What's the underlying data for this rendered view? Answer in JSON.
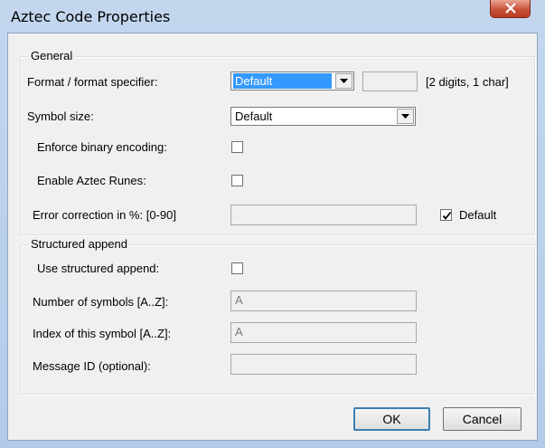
{
  "window": {
    "title": "Aztec Code Properties",
    "close_icon": "close-icon"
  },
  "general": {
    "legend": "General",
    "format_label": "Format / format specifier:",
    "format_value": "Default",
    "format_hint": "[2 digits, 1 char]",
    "format_specifier_value": "",
    "symbol_size_label": "Symbol size:",
    "symbol_size_value": "Default",
    "binary_label": "Enforce binary encoding:",
    "binary_checked": false,
    "runes_label": "Enable Aztec Runes:",
    "runes_checked": false,
    "ecc_label": "Error correction in %: [0-90]",
    "ecc_value": "",
    "ecc_default_label": "Default",
    "ecc_default_checked": true
  },
  "structured": {
    "legend": "Structured append",
    "use_label": "Use structured append:",
    "use_checked": false,
    "num_label": "Number of symbols [A..Z]:",
    "num_value": "A",
    "index_label": "Index of this symbol [A..Z]:",
    "index_value": "A",
    "msgid_label": "Message ID (optional):",
    "msgid_value": ""
  },
  "buttons": {
    "ok": "OK",
    "cancel": "Cancel"
  }
}
